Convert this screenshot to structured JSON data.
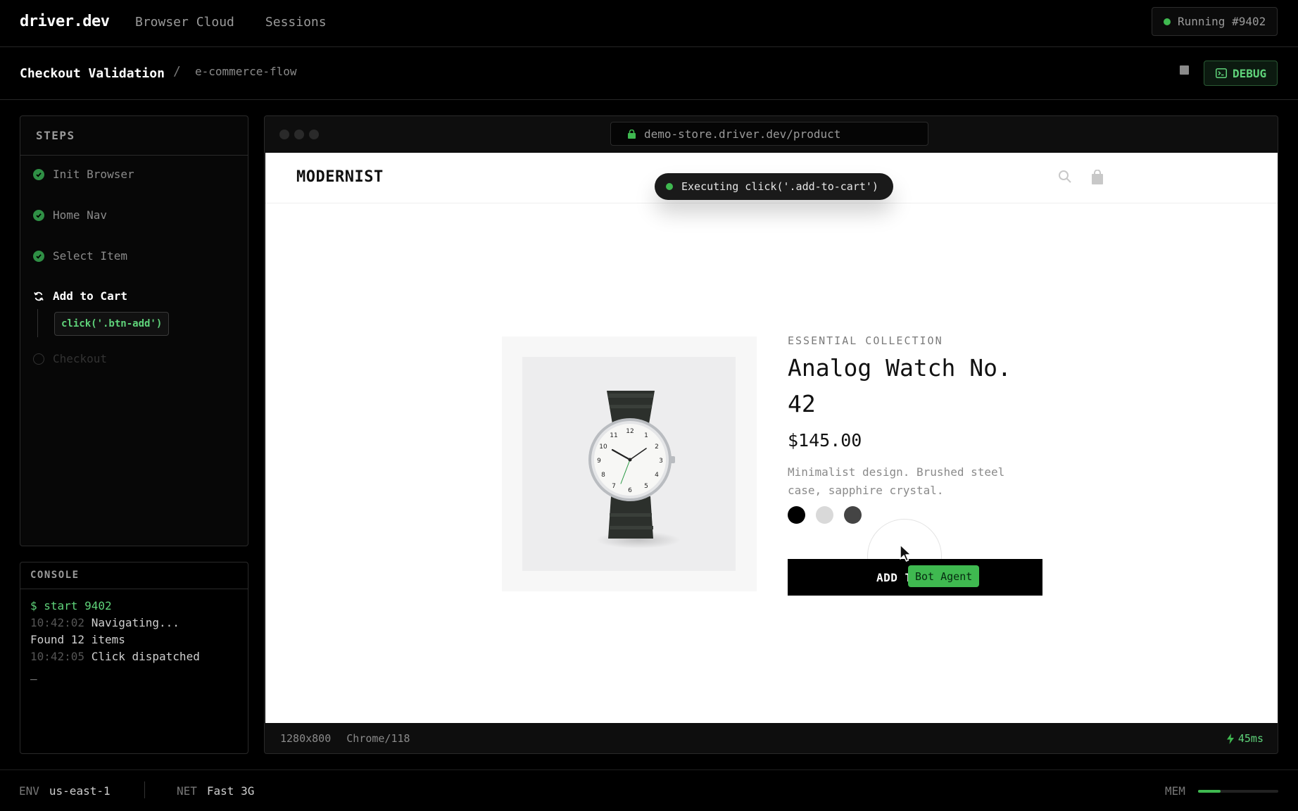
{
  "app": {
    "brand": "driver.dev",
    "nav": [
      "Browser Cloud",
      "Sessions"
    ],
    "run_status": "Running #9402"
  },
  "header": {
    "title": "Checkout Validation",
    "separator": "/",
    "flow": "e-commerce-flow",
    "debug_label": "DEBUG"
  },
  "steps": {
    "heading": "STEPS",
    "items": [
      {
        "label": "Init Browser",
        "status": "done"
      },
      {
        "label": "Home Nav",
        "status": "done"
      },
      {
        "label": "Select Item",
        "status": "done"
      },
      {
        "label": "Add to Cart",
        "status": "running",
        "code": "click('.btn-add')"
      },
      {
        "label": "Checkout",
        "status": "pending"
      }
    ]
  },
  "console": {
    "heading": "CONSOLE",
    "lines": [
      {
        "text": "$ start 9402"
      },
      {
        "time": "10:42:02",
        "text": "Navigating..."
      },
      {
        "text": "Found 12 items"
      },
      {
        "time": "10:42:05",
        "text": "Click dispatched"
      },
      {
        "text": "_"
      }
    ]
  },
  "browser": {
    "url": "demo-store.driver.dev/product",
    "toast": "Executing click('.add-to-cart')",
    "viewport": "1280x800",
    "agent": "Chrome/118",
    "latency": "45ms"
  },
  "store": {
    "logo": "MODERNIST",
    "kicker": "ESSENTIAL COLLECTION",
    "product_title": "Analog Watch No. 42",
    "price": "$145.00",
    "description": "Minimalist design. Brushed steel case, sapphire crystal.",
    "swatches": [
      "#000000",
      "#d9d9d9",
      "#444444"
    ],
    "cta_label": "ADD T",
    "bot_label": "Bot Agent"
  },
  "env": {
    "env_label": "ENV",
    "env_value": "us-east-1",
    "net_label": "NET",
    "net_value": "Fast 3G",
    "mem_label": "MEM",
    "mem_fraction": 0.28
  },
  "colors": {
    "accent": "#3fb950",
    "background": "#000000"
  }
}
